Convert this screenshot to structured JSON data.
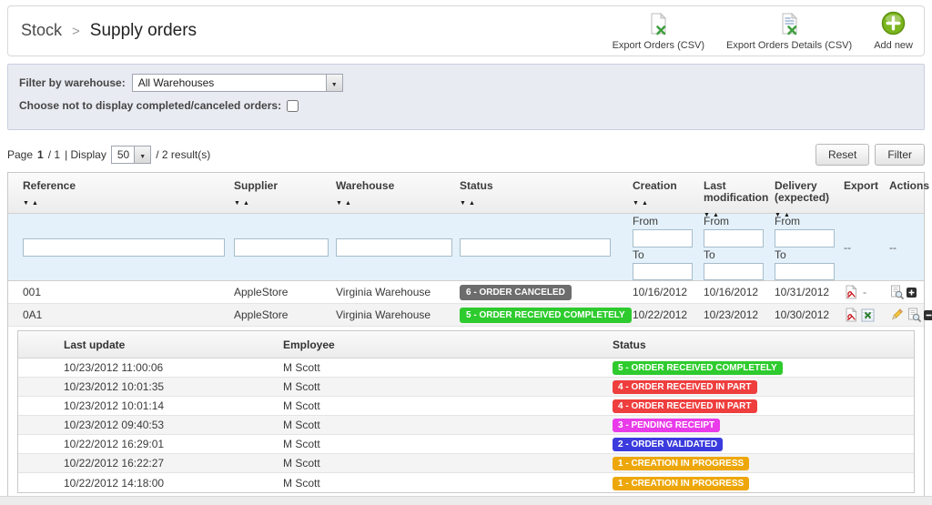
{
  "header": {
    "breadcrumb": "Stock",
    "separator": ">",
    "title": "Supply orders",
    "actions": {
      "export_orders": "Export Orders (CSV)",
      "export_details": "Export Orders Details (CSV)",
      "add_new": "Add new"
    }
  },
  "filters": {
    "warehouse_label": "Filter by warehouse:",
    "warehouse_selected": "All Warehouses",
    "hide_completed_label": "Choose not to display completed/canceled orders:"
  },
  "pager": {
    "page_label": "Page",
    "page": "1",
    "page_total": "/ 1",
    "display_label": "| Display",
    "page_size": "50",
    "results": "/ 2 result(s)",
    "reset": "Reset",
    "filter": "Filter"
  },
  "table": {
    "columns": {
      "reference": "Reference",
      "supplier": "Supplier",
      "warehouse": "Warehouse",
      "status": "Status",
      "creation": "Creation",
      "last_modification": "Last modification",
      "delivery": "Delivery (expected)",
      "export": "Export",
      "actions": "Actions"
    },
    "filter_row": {
      "from": "From",
      "to": "To",
      "export_placeholder": "--",
      "actions_placeholder": "--"
    },
    "rows": [
      {
        "reference": "001",
        "supplier": "AppleStore",
        "warehouse": "Virginia Warehouse",
        "status": "6 - ORDER CANCELED",
        "status_color": "#6C6C6C",
        "creation": "10/16/2012",
        "last_modification": "10/16/2012",
        "delivery": "10/31/2012",
        "export_icons": [
          "pdf-icon"
        ],
        "export_note": "-",
        "action_icons": [
          "details-icon",
          "expand-icon"
        ]
      },
      {
        "reference": "0A1",
        "supplier": "AppleStore",
        "warehouse": "Virginia Warehouse",
        "status": "5 - ORDER RECEIVED COMPLETELY",
        "status_color": "#2ECB2E",
        "creation": "10/22/2012",
        "last_modification": "10/23/2012",
        "delivery": "10/30/2012",
        "export_icons": [
          "pdf-icon",
          "excel-icon"
        ],
        "export_note": "",
        "action_icons": [
          "edit-icon",
          "details-icon",
          "collapse-icon"
        ]
      }
    ]
  },
  "details": {
    "columns": {
      "last_update": "Last update",
      "employee": "Employee",
      "status": "Status"
    },
    "rows": [
      {
        "last_update": "10/23/2012 11:00:06",
        "employee": "M Scott",
        "status": "5 - ORDER RECEIVED COMPLETELY",
        "status_color": "#2ECB2E"
      },
      {
        "last_update": "10/23/2012 10:01:35",
        "employee": "M Scott",
        "status": "4 - ORDER RECEIVED IN PART",
        "status_color": "#EF3E3E"
      },
      {
        "last_update": "10/23/2012 10:01:14",
        "employee": "M Scott",
        "status": "4 - ORDER RECEIVED IN PART",
        "status_color": "#EF3E3E"
      },
      {
        "last_update": "10/23/2012 09:40:53",
        "employee": "M Scott",
        "status": "3 - PENDING RECEIPT",
        "status_color": "#E93BE9"
      },
      {
        "last_update": "10/22/2012 16:29:01",
        "employee": "M Scott",
        "status": "2 - ORDER VALIDATED",
        "status_color": "#3B3BDE"
      },
      {
        "last_update": "10/22/2012 16:22:27",
        "employee": "M Scott",
        "status": "1 - CREATION IN PROGRESS",
        "status_color": "#EDA70A"
      },
      {
        "last_update": "10/22/2012 14:18:00",
        "employee": "M Scott",
        "status": "1 - CREATION IN PROGRESS",
        "status_color": "#EDA70A"
      }
    ]
  }
}
